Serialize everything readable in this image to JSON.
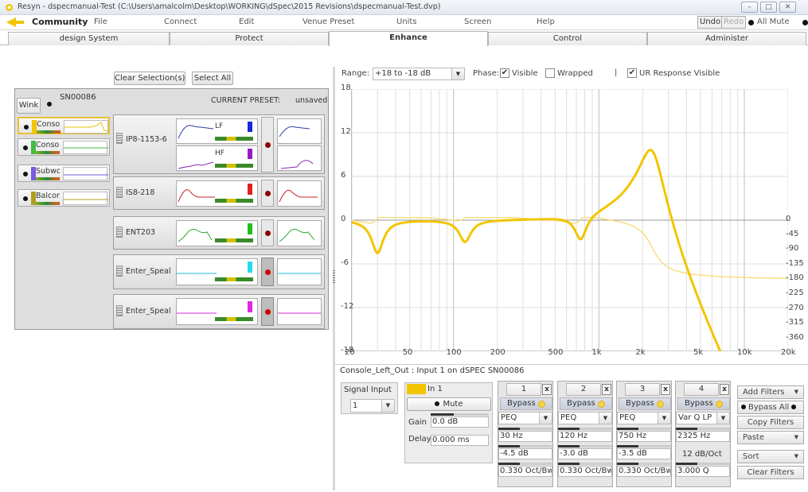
{
  "window": {
    "title": "Resyn - dspecmanual-Test (C:\\Users\\amalcolm\\Desktop\\WORKING\\dSpec\\2015 Revisions\\dspecmanual-Test.dvp)",
    "minimize": "–",
    "maximize": "□",
    "close": "✕"
  },
  "menubar": {
    "brand": "Community",
    "items": [
      "File",
      "Connect",
      "Edit",
      "Venue Preset",
      "Units",
      "Screen",
      "Help"
    ],
    "undo": "Undo",
    "redo": "Redo",
    "all_mute": "All Mute"
  },
  "tabs": [
    {
      "label": "design System"
    },
    {
      "label": "Protect"
    },
    {
      "label": "Enhance",
      "active": true
    },
    {
      "label": "Control"
    },
    {
      "label": "Administer"
    }
  ],
  "left": {
    "clear_selection": "Clear Selection(s)",
    "select_all": "Select All",
    "wink": "Wink",
    "serial": "SN00086",
    "current_preset_label": "CURRENT PRESET:",
    "current_preset_value": "unsaved",
    "sources": [
      {
        "label": "Console",
        "color": "#e8c000",
        "selected": true
      },
      {
        "label": "Console",
        "color": "#44bb44",
        "selected": false
      },
      {
        "label": "Subwoo",
        "color": "#7a5ae0",
        "selected": false
      },
      {
        "label": "Balcony",
        "color": "#b0a020",
        "selected": false
      }
    ],
    "speakers": [
      {
        "name": "IP8-1153-6",
        "bands": [
          "LF",
          "HF"
        ]
      },
      {
        "name": "IS8-218",
        "bands": []
      },
      {
        "name": "ENT203",
        "bands": []
      },
      {
        "name": "Enter_Speal",
        "bands": []
      },
      {
        "name": "Enter_Speal",
        "bands": []
      }
    ]
  },
  "plot_controls": {
    "range_label": "Range:",
    "range_value": "+18 to -18 dB",
    "phase_label": "Phase:",
    "visible_label": "Visible",
    "visible_checked": true,
    "wrapped_label": "Wrapped",
    "wrapped_checked": false,
    "separator": "|",
    "ur_label": "UR Response Visible",
    "ur_checked": true
  },
  "plot": {
    "y_ticks": [
      "18",
      "12",
      "6",
      "0",
      "-6",
      "-12",
      "-18"
    ],
    "x_ticks": [
      "20",
      "50",
      "100",
      "200",
      "500",
      "1k",
      "2k",
      "5k",
      "10k",
      "20k"
    ],
    "phase_ticks": [
      "0",
      "-45",
      "-90",
      "-135",
      "-180",
      "-225",
      "-270",
      "-315",
      "-360"
    ],
    "curve_color": "#f2c500",
    "phase_color": "#f7dc7a"
  },
  "status_line": "Console_Left_Out : Input 1 on dSPEC SN00086",
  "signal": {
    "label": "Signal Input",
    "value": "1"
  },
  "input": {
    "name": "In 1",
    "mute": "Mute",
    "gain_label": "Gain",
    "gain_value": "0.0 dB",
    "delay_label": "Delay",
    "delay_value": "0.000 ms"
  },
  "filters": [
    {
      "num": "1",
      "bypass": "Bypass",
      "type": "PEQ",
      "freq": "30 Hz",
      "gain": "-4.5 dB",
      "q": "0.330 Oct/Bw"
    },
    {
      "num": "2",
      "bypass": "Bypass",
      "type": "PEQ",
      "freq": "120 Hz",
      "gain": "-3.0 dB",
      "q": "0.330 Oct/Bw"
    },
    {
      "num": "3",
      "bypass": "Bypass",
      "type": "PEQ",
      "freq": "750 Hz",
      "gain": "-3.5 dB",
      "q": "0.330 Oct/Bw"
    },
    {
      "num": "4",
      "bypass": "Bypass",
      "type": "Var Q LP",
      "freq": "2325 Hz",
      "slope": "12 dB/Oct",
      "q": "3.000 Q"
    }
  ],
  "filter_actions": {
    "add": "Add Filters",
    "bypass_all": "Bypass All",
    "copy": "Copy Filters",
    "paste": "Paste",
    "sort": "Sort",
    "clear": "Clear Filters"
  }
}
